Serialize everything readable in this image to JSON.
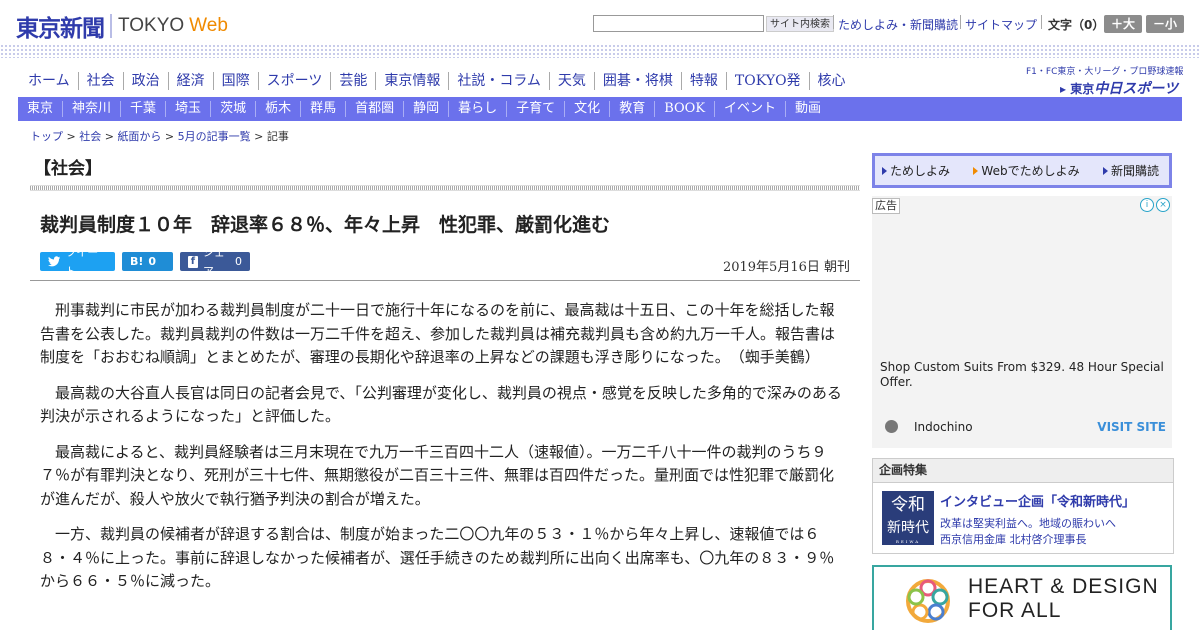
{
  "header": {
    "logo_jp": "東京新聞",
    "logo_en": "TOKYO",
    "logo_web": "Web",
    "search_button": "サイト内検索",
    "tameshi_link": "ためしよみ・新聞購読",
    "sitemap_link": "サイトマップ",
    "fontsize_label": "文字（0）",
    "size_large": "＋大",
    "size_small": "－小"
  },
  "main_nav": [
    "ホーム",
    "社会",
    "政治",
    "経済",
    "国際",
    "スポーツ",
    "芸能",
    "東京情報",
    "社説・コラム",
    "天気",
    "囲碁・将棋",
    "特報",
    "TOKYO発",
    "核心"
  ],
  "chunichi": {
    "tagline": "F1・FC東京・大リーグ・プロ野球速報",
    "prefix": "東京",
    "name": "中日スポーツ"
  },
  "sub_nav": [
    "東京",
    "神奈川",
    "千葉",
    "埼玉",
    "茨城",
    "栃木",
    "群馬",
    "首都圏",
    "静岡",
    "暮らし",
    "子育て",
    "文化",
    "教育",
    "BOOK",
    "イベント",
    "動画"
  ],
  "breadcrumb": {
    "items": [
      "トップ",
      "社会",
      "紙面から",
      "5月の記事一覧"
    ],
    "current": "記事",
    "sep": " > "
  },
  "article": {
    "section": "【社会】",
    "headline": "裁判員制度１０年　辞退率６８％、年々上昇　性犯罪、厳罰化進む",
    "tweet_label": "ツイート",
    "hatena_label": "B!",
    "hatena_count": "0",
    "fb_label": "シェア",
    "fb_count": "0",
    "date": "2019年5月16日 朝刊",
    "paragraphs": [
      "刑事裁判に市民が加わる裁判員制度が二十一日で施行十年になるのを前に、最高裁は十五日、この十年を総括した報告書を公表した。裁判員裁判の件数は一万二千件を超え、参加した裁判員は補充裁判員も含め約九万一千人。報告書は制度を「おおむね順調」とまとめたが、審理の長期化や辞退率の上昇などの課題も浮き彫りになった。　（蜘手美鶴）",
      "最高裁の大谷直人長官は同日の記者会見で、「公判審理が変化し、裁判員の視点・感覚を反映した多角的で深みのある判決が示されるようになった」と評価した。",
      "最高裁によると、裁判員経験者は三月末現在で九万一千三百四十二人（速報値）。一万二千八十一件の裁判のうち９７％が有罪判決となり、死刑が三十七件、無期懲役が二百三十三件、無罪は百四件だった。量刑面では性犯罪で厳罰化が進んだが、殺人や放火で執行猶予判決の割合が増えた。",
      "一方、裁判員の候補者が辞退する割合は、制度が始まった二〇〇九年の５３・１％から年々上昇し、速報値では６８・４％に上った。事前に辞退しなかった候補者が、選任手続きのため裁判所に出向く出席率も、〇九年の８３・９％から６６・５％に減った。"
    ]
  },
  "sidebar": {
    "subscribe": [
      "ためしよみ",
      "Webでためしよみ",
      "新聞購読"
    ],
    "ad": {
      "label": "広告",
      "text": "Shop Custom Suits From $329. 48 Hour Special Offer.",
      "sponsor": "Indochino",
      "cta": "VISIT SITE",
      "icon_info": "i",
      "icon_close": "×"
    },
    "kikaku": {
      "heading": "企画特集",
      "img_line1": "令和",
      "img_line2": "新時代",
      "img_small": "REIWA",
      "title": "インタビュー企画「令和新時代」",
      "sub1": "改革は堅実利益へ。地域の賑わいへ",
      "sub2": "西京信用金庫 北村啓介理事長"
    },
    "banner": {
      "line1": "HEART & DESIGN",
      "line2": "FOR ALL"
    }
  },
  "colors": {
    "brand": "#2f3bab",
    "subnav": "#6b71ec",
    "web_accent": "#f08a00",
    "twitter": "#1da1f2",
    "hatena": "#1f8dd6",
    "facebook": "#3b5998",
    "banner_border": "#38a6a0"
  }
}
